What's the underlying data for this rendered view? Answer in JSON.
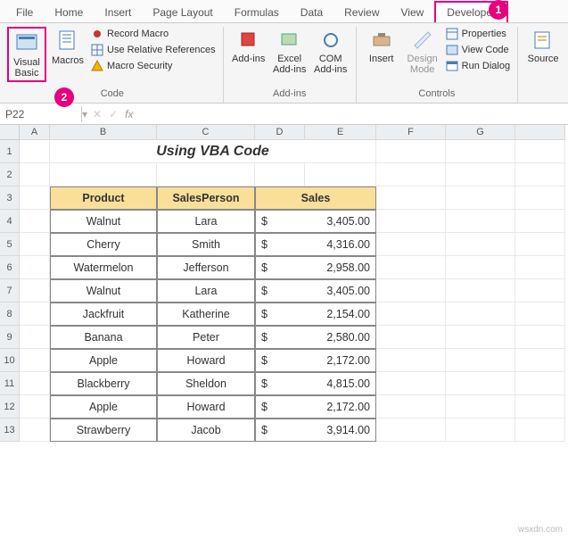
{
  "tabs": [
    "File",
    "Home",
    "Insert",
    "Page Layout",
    "Formulas",
    "Data",
    "Review",
    "View",
    "Developer"
  ],
  "activeTabIndex": 8,
  "ribbon": {
    "code": {
      "visualBasic": "Visual Basic",
      "macros": "Macros",
      "recordMacro": "Record Macro",
      "relRef": "Use Relative References",
      "macroSec": "Macro Security",
      "label": "Code"
    },
    "addins": {
      "addins": "Add-ins",
      "excelAddins": "Excel Add-ins",
      "comAddins": "COM Add-ins",
      "label": "Add-ins"
    },
    "controls": {
      "insert": "Insert",
      "designMode": "Design Mode",
      "properties": "Properties",
      "viewCode": "View Code",
      "runDialog": "Run Dialog",
      "label": "Controls"
    },
    "xml": {
      "source": "Source"
    }
  },
  "callouts": {
    "developer": "1",
    "visualBasic": "2"
  },
  "namebox": "P22",
  "fx": "fx",
  "columns": [
    "A",
    "B",
    "C",
    "D",
    "E",
    "F",
    "G"
  ],
  "rowCount": 13,
  "title": "Using VBA Code",
  "headers": {
    "product": "Product",
    "salesperson": "SalesPerson",
    "sales": "Sales"
  },
  "currency": "$",
  "rows": [
    {
      "p": "Walnut",
      "s": "Lara",
      "v": "3,405.00"
    },
    {
      "p": "Cherry",
      "s": "Smith",
      "v": "4,316.00"
    },
    {
      "p": "Watermelon",
      "s": "Jefferson",
      "v": "2,958.00"
    },
    {
      "p": "Walnut",
      "s": "Lara",
      "v": "3,405.00"
    },
    {
      "p": "Jackfruit",
      "s": "Katherine",
      "v": "2,154.00"
    },
    {
      "p": "Banana",
      "s": "Peter",
      "v": "2,580.00"
    },
    {
      "p": "Apple",
      "s": "Howard",
      "v": "2,172.00"
    },
    {
      "p": "Blackberry",
      "s": "Sheldon",
      "v": "4,815.00"
    },
    {
      "p": "Apple",
      "s": "Howard",
      "v": "2,172.00"
    },
    {
      "p": "Strawberry",
      "s": "Jacob",
      "v": "3,914.00"
    }
  ],
  "watermark": "wsxdn.com"
}
